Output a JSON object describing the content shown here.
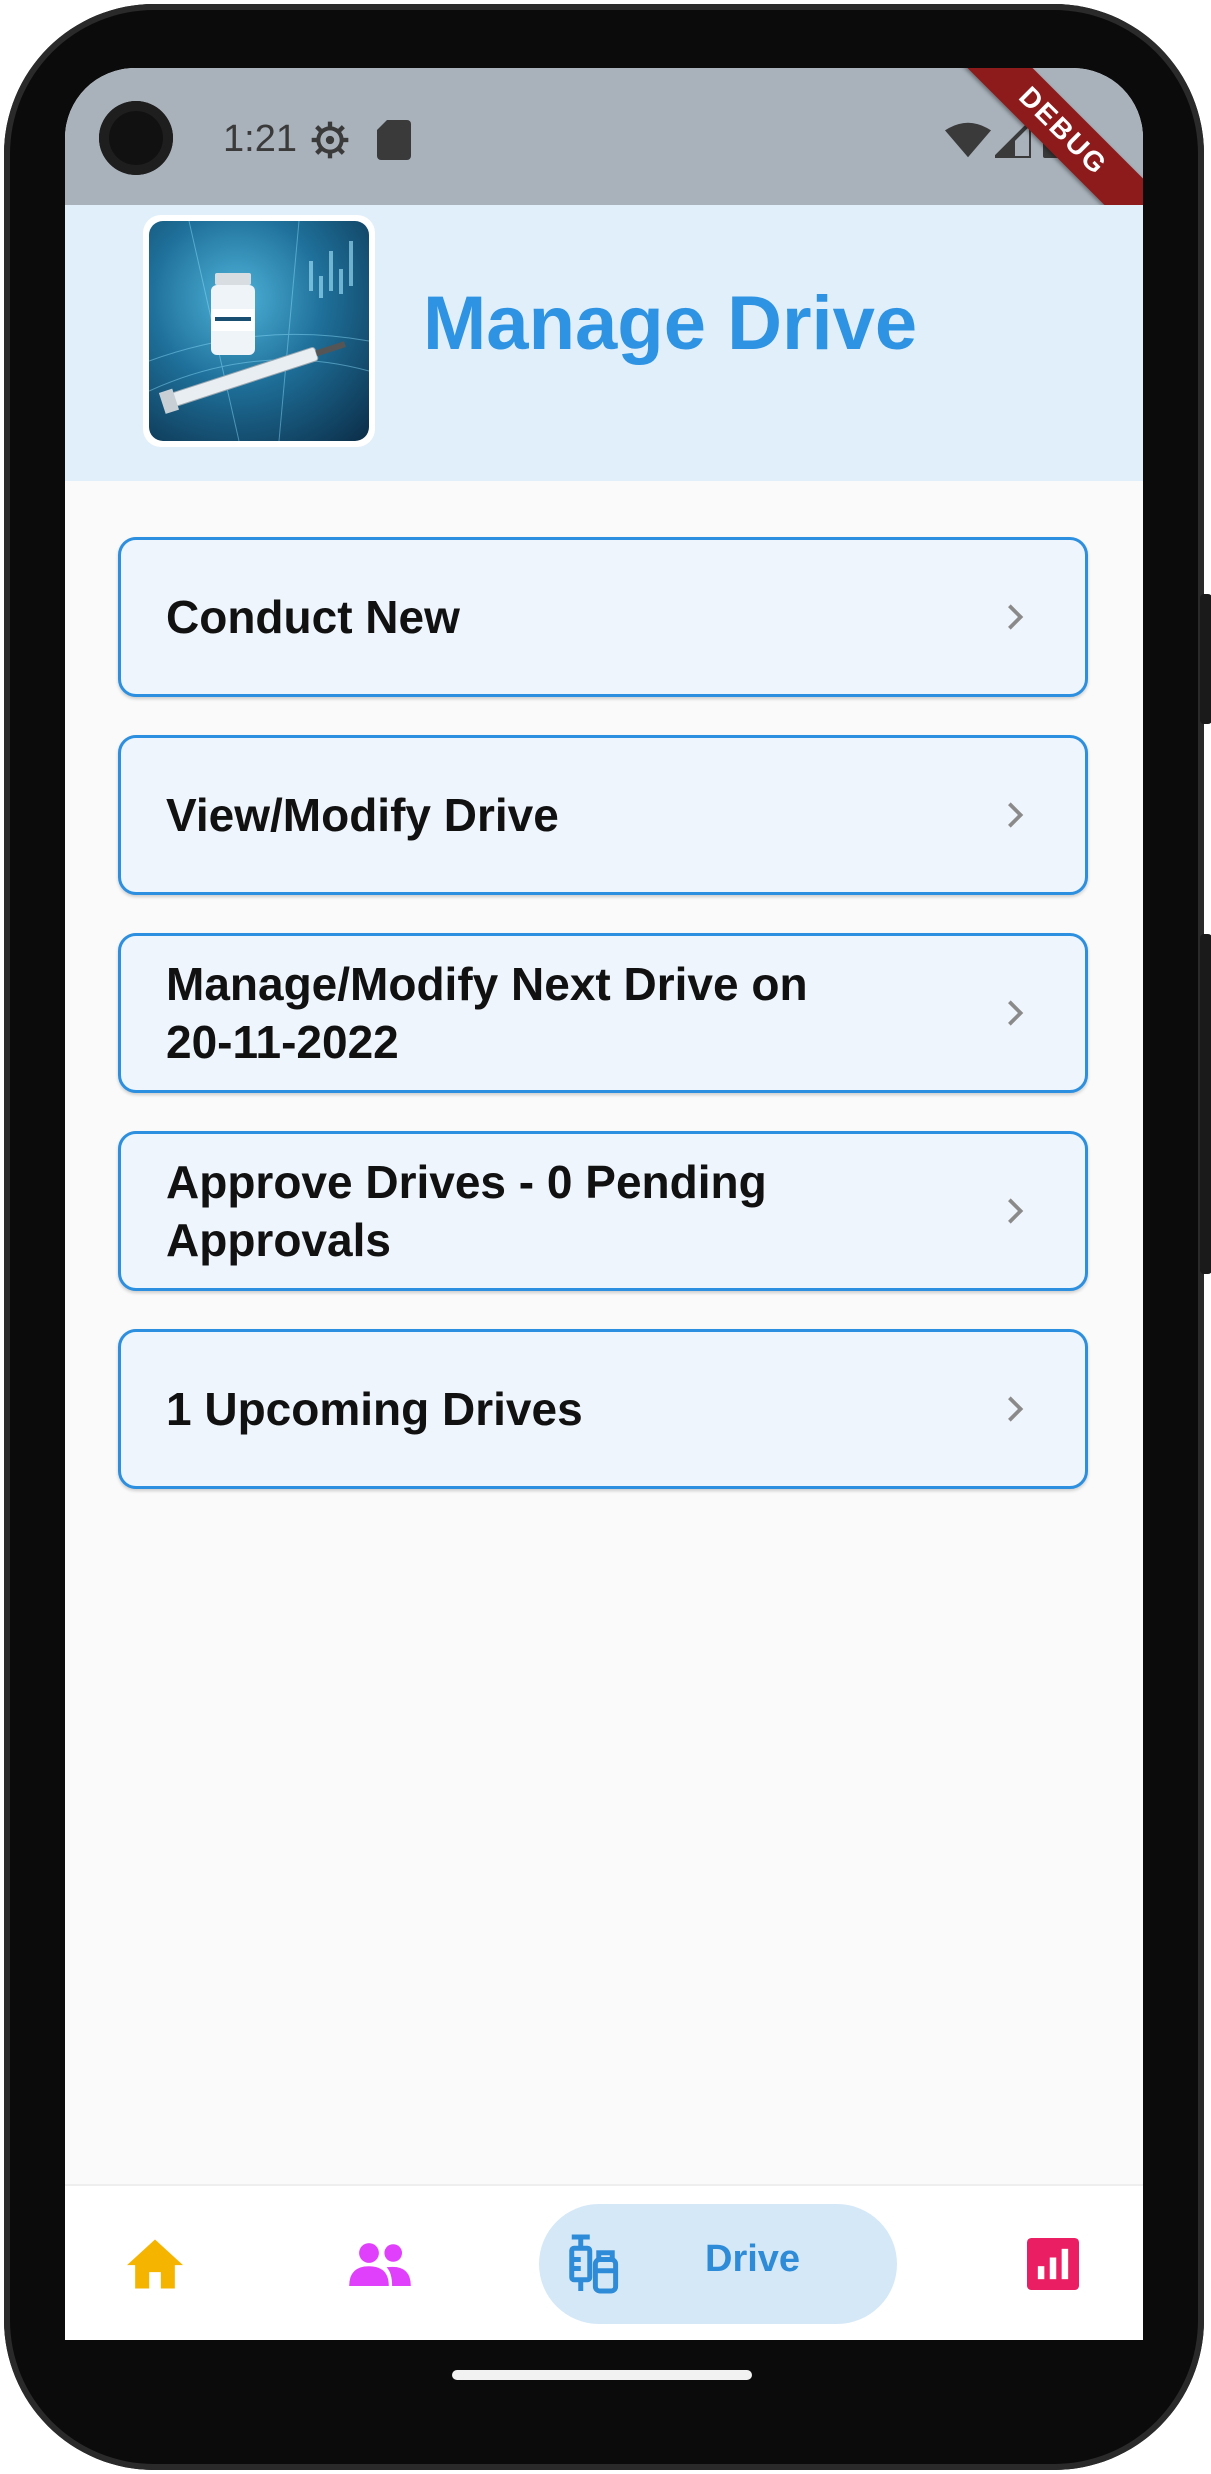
{
  "status_bar": {
    "time": "1:21",
    "debug_label": "DEBUG",
    "icons": [
      "settings-icon",
      "sd-card-icon",
      "wifi-icon",
      "signal-icon",
      "battery-icon"
    ]
  },
  "header": {
    "title": "Manage Drive",
    "logo": "vaccine-logo"
  },
  "menu": {
    "items": [
      {
        "label": "Conduct New"
      },
      {
        "label": "View/Modify Drive"
      },
      {
        "label": "Manage/Modify Next Drive on 20-11-2022"
      },
      {
        "label": "Approve Drives - 0 Pending Approvals"
      },
      {
        "label": "1 Upcoming Drives"
      }
    ]
  },
  "bottom_nav": {
    "items": [
      {
        "icon": "home-icon",
        "color": "#f5b400"
      },
      {
        "icon": "people-icon",
        "color": "#e040fb"
      },
      {
        "icon": "vaccine-icon",
        "label": "Drive",
        "color": "#2e8bd7",
        "active": true
      },
      {
        "icon": "bar-chart-icon",
        "color": "#e91e63"
      }
    ]
  },
  "colors": {
    "accent": "#2e93e3",
    "header_bg": "#e1effa",
    "card_bg": "#eef5fc",
    "card_border": "#2c8fdf"
  }
}
